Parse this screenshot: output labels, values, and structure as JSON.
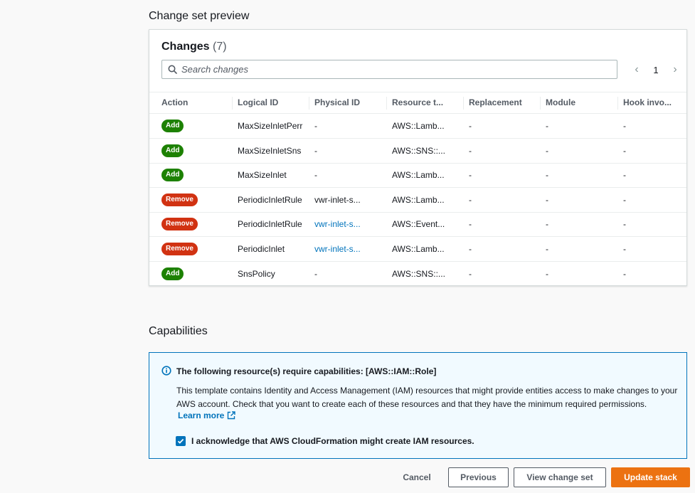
{
  "preview": {
    "title": "Change set preview",
    "changes_label": "Changes",
    "changes_count": "(7)",
    "search_placeholder": "Search changes",
    "page_number": "1",
    "columns": [
      "Action",
      "Logical ID",
      "Physical ID",
      "Resource t...",
      "Replacement",
      "Module",
      "Hook invo..."
    ],
    "rows": [
      {
        "action": "Add",
        "logical_id": "MaxSizeInletPerr",
        "physical_id": "-",
        "physical_is_link": false,
        "resource_type": "AWS::Lamb...",
        "replacement": "-",
        "module": "-",
        "hook": "-"
      },
      {
        "action": "Add",
        "logical_id": "MaxSizeInletSns",
        "physical_id": "-",
        "physical_is_link": false,
        "resource_type": "AWS::SNS::...",
        "replacement": "-",
        "module": "-",
        "hook": "-"
      },
      {
        "action": "Add",
        "logical_id": "MaxSizeInlet",
        "physical_id": "-",
        "physical_is_link": false,
        "resource_type": "AWS::Lamb...",
        "replacement": "-",
        "module": "-",
        "hook": "-"
      },
      {
        "action": "Remove",
        "logical_id": "PeriodicInletRule",
        "physical_id": "vwr-inlet-s...",
        "physical_is_link": false,
        "resource_type": "AWS::Lamb...",
        "replacement": "-",
        "module": "-",
        "hook": "-"
      },
      {
        "action": "Remove",
        "logical_id": "PeriodicInletRule",
        "physical_id": "vwr-inlet-s...",
        "physical_is_link": true,
        "resource_type": "AWS::Event...",
        "replacement": "-",
        "module": "-",
        "hook": "-"
      },
      {
        "action": "Remove",
        "logical_id": "PeriodicInlet",
        "physical_id": "vwr-inlet-s...",
        "physical_is_link": true,
        "resource_type": "AWS::Lamb...",
        "replacement": "-",
        "module": "-",
        "hook": "-"
      },
      {
        "action": "Add",
        "logical_id": "SnsPolicy",
        "physical_id": "-",
        "physical_is_link": false,
        "resource_type": "AWS::SNS::...",
        "replacement": "-",
        "module": "-",
        "hook": "-"
      }
    ]
  },
  "capabilities": {
    "title": "Capabilities",
    "info_title": "The following resource(s) require capabilities: [AWS::IAM::Role]",
    "info_text": "This template contains Identity and Access Management (IAM) resources that might provide entities access to make changes to your AWS account. Check that you want to create each of these resources and that they have the minimum required permissions.",
    "learn_more": "Learn more",
    "ack_label": "I acknowledge that AWS CloudFormation might create IAM resources.",
    "ack_checked": true
  },
  "footer": {
    "cancel": "Cancel",
    "previous": "Previous",
    "view_change_set": "View change set",
    "update_stack": "Update stack"
  },
  "colors": {
    "add": "#1d8102",
    "remove": "#d13212",
    "link": "#0073bb",
    "primary": "#ec7211"
  },
  "icons": {
    "search": "search-icon",
    "info": "info-icon",
    "external": "external-link-icon",
    "check": "check-icon"
  }
}
